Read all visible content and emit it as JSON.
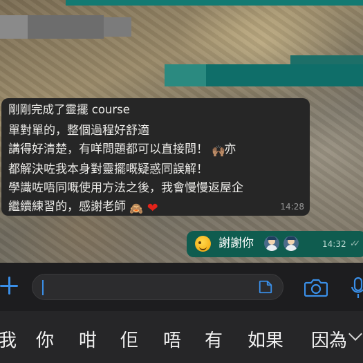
{
  "chat": {
    "incoming": {
      "title": "剛剛完成了靈擺 course",
      "lines": [
        "單對單的，整個過程好舒適",
        "講得好清楚，有咩問題都可以直接問！",
        "亦",
        "都解決咗我本身對靈擺嘅疑惑同誤解！",
        "學識咗唔同嘅使用方法之後，我會慢慢返屋企",
        "繼續練習的，感謝老師"
      ],
      "emoji_raised_hands": "🙌🏽",
      "emoji_monkey": "🙈",
      "emoji_heart": "❤",
      "time": "14:28"
    },
    "outgoing": {
      "text": "謝謝你",
      "time": "14:32",
      "ticks": "✓✓"
    }
  },
  "input": {
    "placeholder": "",
    "accent_color": "#3a8fe8"
  },
  "keyboard": {
    "suggestions": [
      "我",
      "你",
      "咁",
      "佢",
      "唔",
      "有",
      "如果",
      "因為"
    ]
  },
  "colors": {
    "bubble_in": "#262626",
    "bubble_out": "#0f5c4f",
    "input_bar": "#1d1d1f",
    "keyboard": "#262628"
  }
}
